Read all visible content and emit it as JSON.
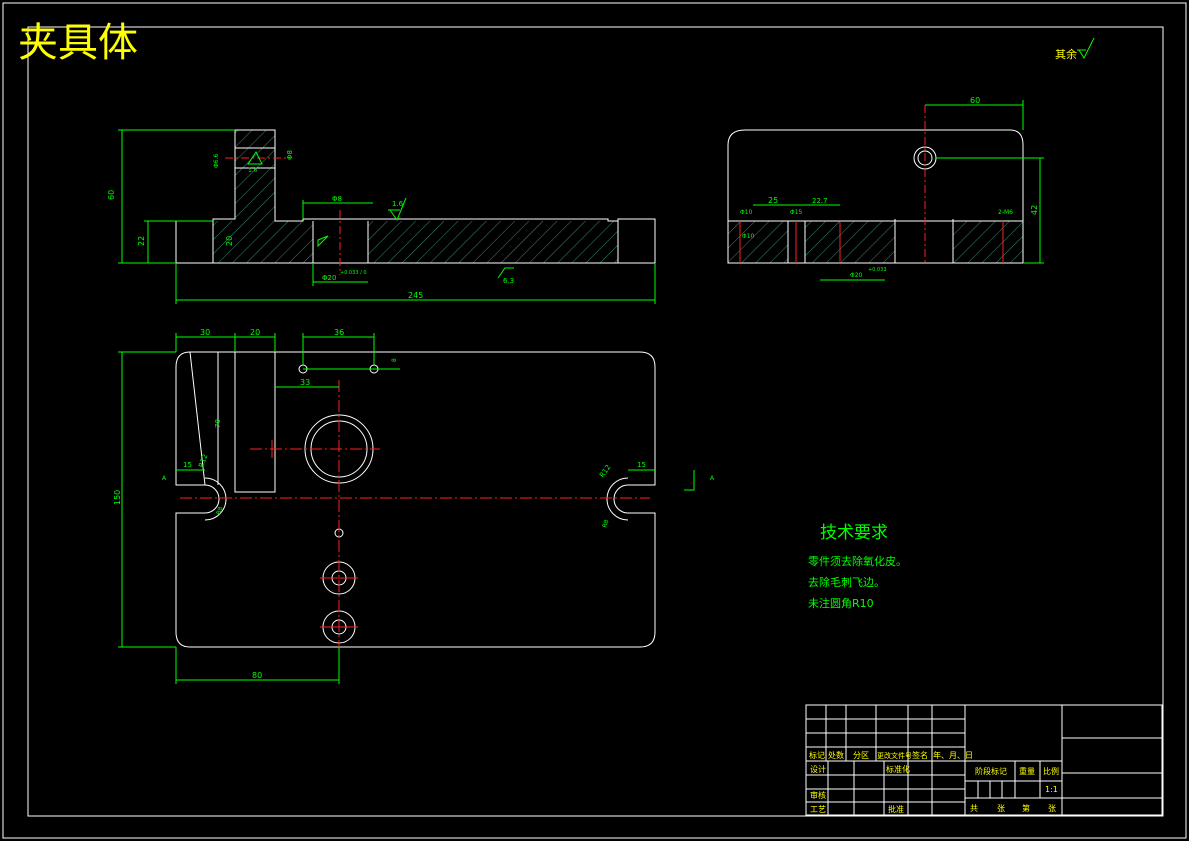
{
  "drawing_title": "夹具体",
  "surface_finish_note": "其余",
  "roughness": {
    "upper_left": "1.6",
    "upper_mid": "1.6",
    "bottom": "6.3"
  },
  "dims_front_view": {
    "height_total": "60",
    "height_base": "22",
    "step_height": "20",
    "bore_label": "Φ20",
    "bore_tol": "+0.033 / 0",
    "length_total": "245",
    "pin_hole": "Φ8",
    "slot_label": "Φ8"
  },
  "dims_side_view": {
    "width_top": "60",
    "width_25": "25",
    "width_22": "22.7",
    "h_right": "42",
    "left_small": "Φ10",
    "mid_small": "Φ15",
    "right_small": "2-M6",
    "tol_note": "+0.033",
    "bottom_dim": "Φ20"
  },
  "dims_top_view": {
    "left_w1": "30",
    "left_w2": "20",
    "hole_spacing": "36",
    "offset_33": "33",
    "height_total": "150",
    "block_height": "70",
    "slot_left": "15",
    "slot_right": "15",
    "radius_left": "R12",
    "radius_right": "R12",
    "bottom_width": "80",
    "section_mark_left": "A",
    "section_mark_right": "A",
    "small_r": "8"
  },
  "tech_requirements": {
    "heading": "技术要求",
    "items": [
      "零件须去除氧化皮。",
      "去除毛刺飞边。",
      "未注圆角R10"
    ]
  },
  "title_block": {
    "header_cells": [
      "标记",
      "处数",
      "分区",
      "更改文件号",
      "签名",
      "年、月、日"
    ],
    "row_design": "设计",
    "row_standard": "标准化",
    "row_review": "审核",
    "row_process": "工艺",
    "row_approve": "批准",
    "stage_mark": "阶段标记",
    "weight": "重量",
    "scale": "比例",
    "scale_value": "1:1",
    "sheet_text": [
      "共",
      "张",
      "第",
      "张"
    ]
  }
}
